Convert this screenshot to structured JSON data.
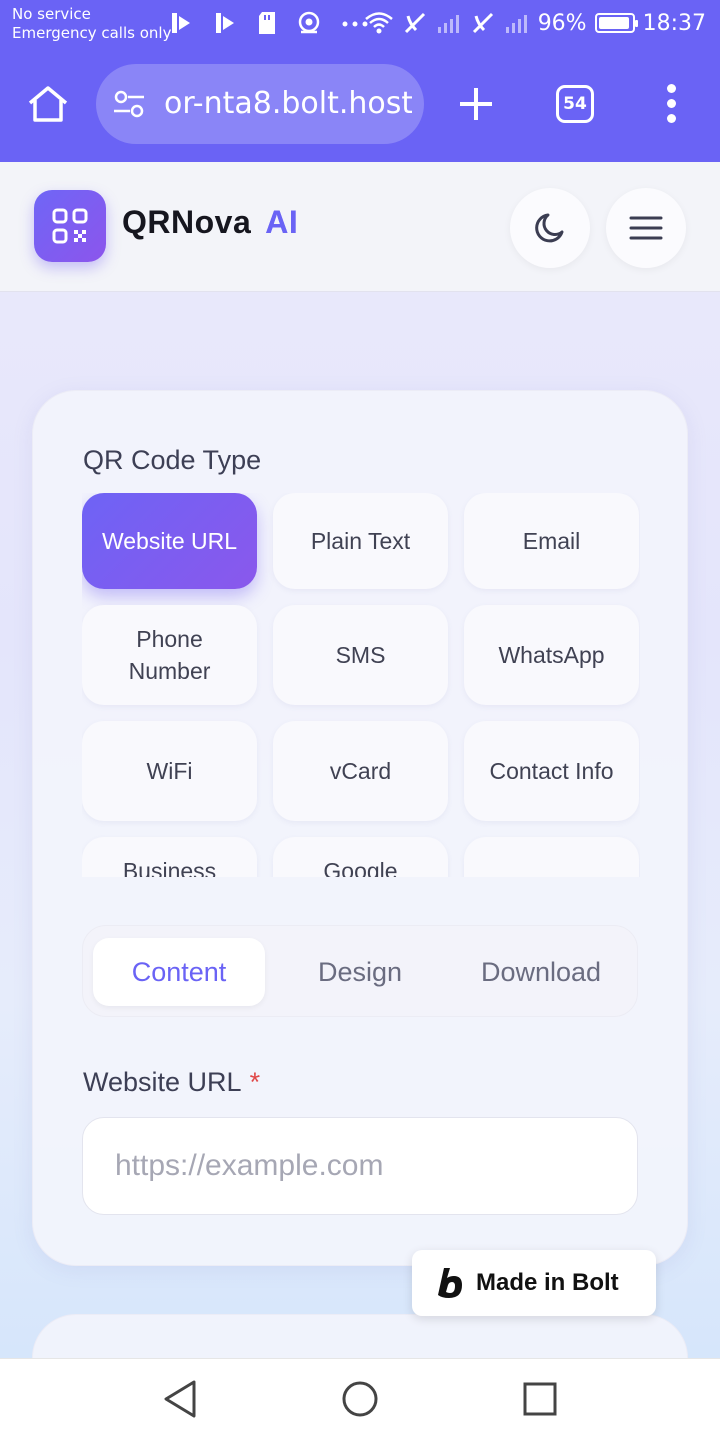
{
  "status_bar": {
    "line1": "No service",
    "line2": "Emergency calls only",
    "battery": "96%",
    "time": "18:37"
  },
  "browser": {
    "url": "or-nta8.bolt.host",
    "tab_count": "54"
  },
  "app": {
    "brand": "QRNova",
    "brand_suffix": "AI"
  },
  "qr_types": {
    "label": "QR Code Type",
    "items": [
      {
        "label": "Website URL",
        "active": true
      },
      {
        "label": "Plain Text",
        "active": false
      },
      {
        "label": "Email",
        "active": false
      },
      {
        "label": "Phone Number",
        "active": false
      },
      {
        "label": "SMS",
        "active": false
      },
      {
        "label": "WhatsApp",
        "active": false
      },
      {
        "label": "WiFi",
        "active": false
      },
      {
        "label": "vCard",
        "active": false
      },
      {
        "label": "Contact Info",
        "active": false
      },
      {
        "label": "Business",
        "active": false
      },
      {
        "label": "Google",
        "active": false
      },
      {
        "label": "",
        "active": false
      }
    ]
  },
  "tabs": {
    "content": "Content",
    "design": "Design",
    "download": "Download",
    "active": "Content"
  },
  "form": {
    "url_label": "Website URL",
    "required_mark": "*",
    "url_placeholder": "https://example.com",
    "url_value": ""
  },
  "badge": {
    "label": "Made in Bolt"
  },
  "colors": {
    "accent": "#6a63f5",
    "accent_end": "#8a58ec",
    "required": "#e04848"
  }
}
